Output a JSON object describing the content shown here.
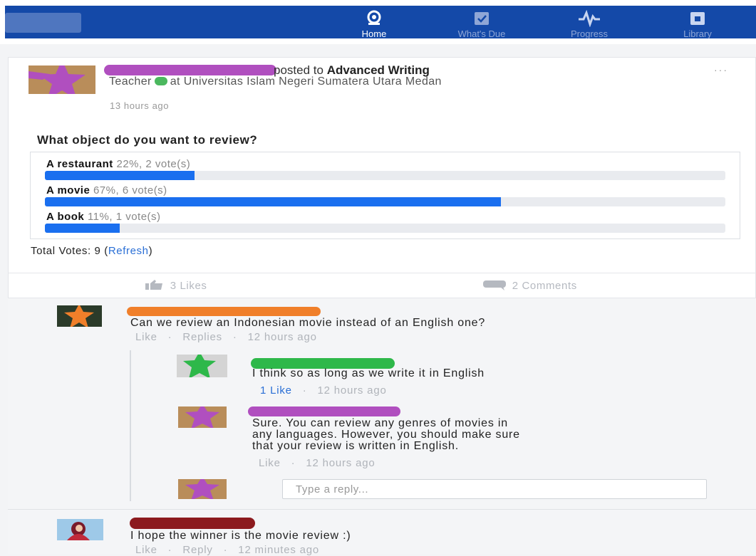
{
  "nav": {
    "tabs": [
      {
        "label": "Home",
        "icon": "home-icon",
        "active": true
      },
      {
        "label": "What's Due",
        "icon": "calendar-icon",
        "active": false
      },
      {
        "label": "Progress",
        "icon": "progress-icon",
        "active": false
      },
      {
        "label": "Library",
        "icon": "library-icon",
        "active": false
      }
    ]
  },
  "post": {
    "posted_to_prefix": "posted to",
    "group": "Advanced Writing",
    "role": "Teacher",
    "institution": "at Universitas Islam Negeri Sumatera Utara Medan",
    "time": "13 hours ago",
    "more": "···"
  },
  "poll": {
    "question": "What object do you want to review?",
    "options": [
      {
        "label": "A restaurant",
        "stat": "22%, 2 vote(s)",
        "percent": 22
      },
      {
        "label": "A movie",
        "stat": "67%, 6 vote(s)",
        "percent": 67
      },
      {
        "label": "A book",
        "stat": "11%, 1 vote(s)",
        "percent": 11
      }
    ],
    "total_prefix": "Total Votes: 9 (",
    "refresh": "Refresh",
    "total_suffix": ")"
  },
  "stats": {
    "likes": "3 Likes",
    "comments": "2 Comments"
  },
  "comments": [
    {
      "text": "Can we review an Indonesian movie instead of an English one?",
      "meta": {
        "like": "Like",
        "sep": "·",
        "replies": "Replies",
        "time": "12 hours ago"
      }
    },
    {
      "text": "I hope the winner is the movie review :)",
      "meta": {
        "like": "Like",
        "sep": "·",
        "replies": "Reply",
        "time": "12 minutes ago"
      }
    }
  ],
  "replies": [
    {
      "text": "I think so as long as we write it in English",
      "meta": {
        "like": "1 Like",
        "sep": "·",
        "time": "12 hours ago"
      }
    },
    {
      "lines": [
        "Sure. You can review any genres of movies in",
        "any languages. However, you should make sure",
        "that your review is written in English."
      ],
      "meta": {
        "like": "Like",
        "sep": "·",
        "time": "12 hours ago"
      }
    }
  ],
  "reply_input": {
    "placeholder": "Type a reply..."
  },
  "colors": {
    "navbar": "#1449a8",
    "accent": "#1a6fef",
    "redact_purple": "#b04fbf",
    "redact_orange": "#f07f2a",
    "redact_green": "#2eb84a",
    "redact_maroon": "#8c1a1e"
  }
}
